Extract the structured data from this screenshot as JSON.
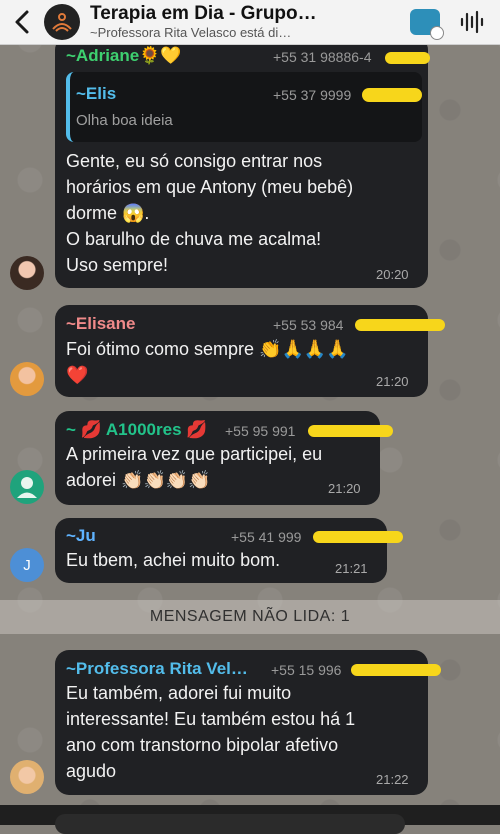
{
  "header": {
    "title": "Terapia em Dia - Grupo…",
    "subtitle": "~Professora Rita Velasco está di…",
    "icons": [
      "back-chevron-icon",
      "video-call-icon",
      "audio-call-icon"
    ]
  },
  "messages": [
    {
      "sender": "~Adriane",
      "sender_emoji": "🌻💛",
      "phone": "+55 31 98886-4",
      "quote_sender": "~Elis",
      "quote_phone": "+55 37 9999",
      "quote_text": "Olha boa ideia",
      "lines": [
        "Gente, eu só consigo entrar nos",
        "horários em que Antony (meu bebê)",
        "dorme 😱.",
        "O barulho de chuva me acalma!",
        "Uso sempre!"
      ],
      "time": "20:20"
    },
    {
      "sender": "~Elisane",
      "phone": "+55 53 984",
      "lines": [
        "Foi ótimo como sempre 👏🙏🙏🙏",
        "❤️"
      ],
      "time": "21:20"
    },
    {
      "sender": "~ 💋 A1000res 💋",
      "phone": "+55 95 991",
      "lines": [
        "A primeira vez que participei, eu",
        "adorei 👏🏻👏🏻👏🏻👏🏻"
      ],
      "time": "21:20"
    },
    {
      "sender": "~Ju",
      "phone": "+55 41 999",
      "avatar_letter": "J",
      "lines": [
        "Eu tbem, achei muito bom."
      ],
      "time": "21:21"
    },
    {
      "sender": "~Professora Rita Vel…",
      "phone": "+55 15 996",
      "lines": [
        "Eu também,  adorei fui muito",
        "interessante! Eu também  estou há 1",
        "ano com transtorno bipolar afetivo",
        "agudo"
      ],
      "time": "21:22"
    }
  ],
  "unread_label": "MENSAGEM NÃO LIDA: 1",
  "colors": {
    "adriane": "#3ed070",
    "elis": "#53bdeb",
    "elisane": "#f08a8a",
    "a1000res": "#22c38a",
    "ju": "#5fb3ff",
    "rita": "#53bdeb",
    "bubble": "#202124",
    "redaction": "#f7d61b"
  }
}
